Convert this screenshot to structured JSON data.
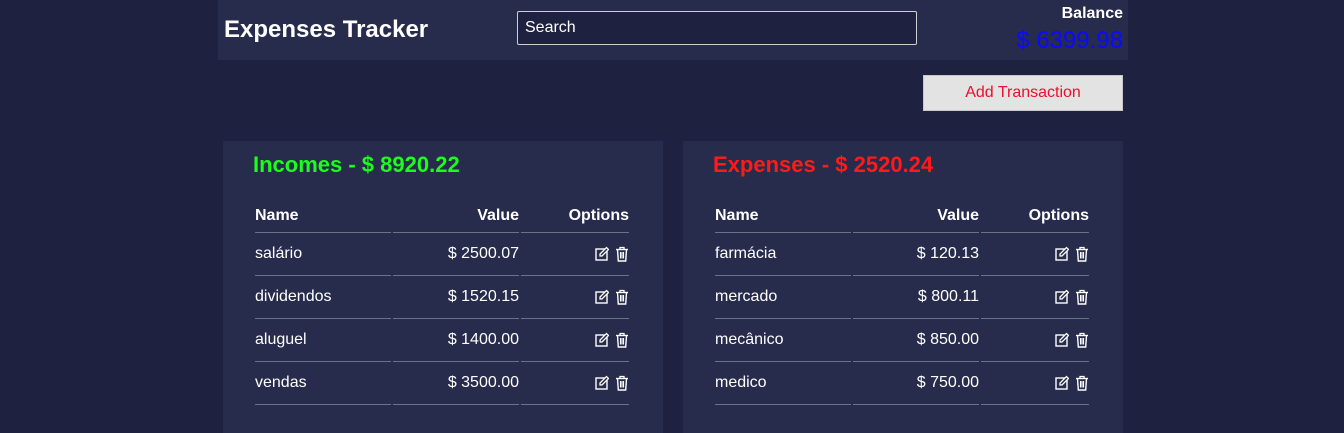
{
  "header": {
    "title": "Expenses Tracker",
    "search_placeholder": "Search",
    "balance_label": "Balance",
    "balance_value": "$ 6399.98"
  },
  "actions": {
    "add_transaction_label": "Add Transaction"
  },
  "incomes": {
    "title": "Incomes - $ 8920.22",
    "columns": [
      "Name",
      "Value",
      "Options"
    ],
    "rows": [
      {
        "name": "salário",
        "value": "$ 2500.07"
      },
      {
        "name": "dividendos",
        "value": "$ 1520.15"
      },
      {
        "name": "aluguel",
        "value": "$ 1400.00"
      },
      {
        "name": "vendas",
        "value": "$ 3500.00"
      }
    ]
  },
  "expenses": {
    "title": "Expenses - $ 2520.24",
    "columns": [
      "Name",
      "Value",
      "Options"
    ],
    "rows": [
      {
        "name": "farmácia",
        "value": "$ 120.13"
      },
      {
        "name": "mercado",
        "value": "$ 800.11"
      },
      {
        "name": "mecânico",
        "value": "$ 850.00"
      },
      {
        "name": "medico",
        "value": "$ 750.00"
      }
    ]
  },
  "icons": {
    "edit": "edit-icon",
    "delete": "trash-icon"
  },
  "colors": {
    "background": "#1e2240",
    "panel": "#272b4c",
    "income_title": "#1aff1a",
    "expense_title": "#ff1a1a",
    "balance_value": "#0a0aff",
    "add_button_text": "#e8102a"
  }
}
